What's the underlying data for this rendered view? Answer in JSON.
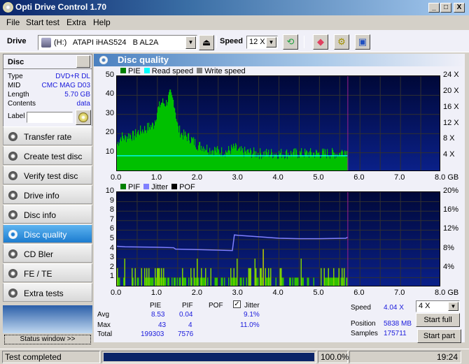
{
  "window": {
    "title": "Opti Drive Control 1.70",
    "minimize": "_",
    "maximize": "□",
    "close": "X"
  },
  "menu": [
    "File",
    "Start test",
    "Extra",
    "Help"
  ],
  "toolbar": {
    "drive_label": "Drive",
    "drive_value": "(H:)   ATAPI iHAS524   B AL2A",
    "speed_label": "Speed",
    "speed_value": "12 X"
  },
  "disc": {
    "header": "Disc",
    "rows": [
      {
        "key": "Type",
        "value": "DVD+R DL"
      },
      {
        "key": "MID",
        "value": "CMC MAG D03"
      },
      {
        "key": "Length",
        "value": "5.70 GB"
      },
      {
        "key": "Contents",
        "value": "data"
      }
    ],
    "label_key": "Label",
    "label_value": ""
  },
  "nav": [
    {
      "label": "Transfer rate",
      "active": false
    },
    {
      "label": "Create test disc",
      "active": false
    },
    {
      "label": "Verify test disc",
      "active": false
    },
    {
      "label": "Drive info",
      "active": false
    },
    {
      "label": "Disc info",
      "active": false
    },
    {
      "label": "Disc quality",
      "active": true
    },
    {
      "label": "CD Bler",
      "active": false
    },
    {
      "label": "FE / TE",
      "active": false
    },
    {
      "label": "Extra tests",
      "active": false
    }
  ],
  "status_window_button": "Status window >>",
  "panel_title": "Disc quality",
  "chart_data": [
    {
      "type": "bar",
      "title": "PIE / Read speed",
      "legend": [
        "PIE",
        "Read speed",
        "Write speed"
      ],
      "legend_colors": [
        "#008000",
        "#00ffff",
        "#808080"
      ],
      "xlabel": "GB",
      "x_ticks": [
        "0.0",
        "1.0",
        "2.0",
        "3.0",
        "4.0",
        "5.0",
        "6.0",
        "7.0",
        "8.0 GB"
      ],
      "xlim": [
        0,
        8
      ],
      "y_ticks": [
        "10",
        "20",
        "30",
        "40",
        "50"
      ],
      "ylim": [
        0,
        50
      ],
      "y2_ticks": [
        "4 X",
        "8 X",
        "12 X",
        "16 X",
        "20 X",
        "24 X"
      ],
      "y2lim": [
        0,
        24
      ],
      "data_end_gb": 5.7,
      "pie_profile": [
        [
          0.0,
          14
        ],
        [
          0.1,
          18
        ],
        [
          0.2,
          17
        ],
        [
          0.3,
          19
        ],
        [
          0.4,
          18
        ],
        [
          0.5,
          20
        ],
        [
          0.6,
          21
        ],
        [
          0.7,
          22
        ],
        [
          0.8,
          23
        ],
        [
          0.9,
          24
        ],
        [
          1.0,
          32
        ],
        [
          1.1,
          36
        ],
        [
          1.2,
          35
        ],
        [
          1.3,
          40
        ],
        [
          1.4,
          36
        ],
        [
          1.5,
          22
        ],
        [
          1.6,
          19
        ],
        [
          1.7,
          18
        ],
        [
          1.8,
          17
        ],
        [
          1.9,
          15
        ],
        [
          2.0,
          13
        ],
        [
          2.1,
          13
        ],
        [
          2.2,
          12
        ],
        [
          2.3,
          11
        ],
        [
          2.4,
          11
        ],
        [
          2.5,
          10
        ],
        [
          2.6,
          10
        ],
        [
          2.7,
          10
        ],
        [
          2.8,
          11
        ],
        [
          2.9,
          12
        ],
        [
          3.0,
          10
        ],
        [
          3.5,
          9
        ],
        [
          4.0,
          9
        ],
        [
          4.5,
          9
        ],
        [
          5.0,
          9
        ],
        [
          5.5,
          9
        ],
        [
          5.6,
          11
        ],
        [
          5.7,
          9
        ]
      ],
      "pie_max": 43,
      "read_speed_x": 4.04
    },
    {
      "type": "bar",
      "title": "PIF / Jitter",
      "legend": [
        "PIF",
        "Jitter",
        "POF"
      ],
      "legend_colors": [
        "#008000",
        "#8080ff",
        "#000000"
      ],
      "xlabel": "GB",
      "x_ticks": [
        "0.0",
        "1.0",
        "2.0",
        "3.0",
        "4.0",
        "5.0",
        "6.0",
        "7.0",
        "8.0 GB"
      ],
      "xlim": [
        0,
        8
      ],
      "y_ticks": [
        "1",
        "2",
        "3",
        "4",
        "5",
        "6",
        "7",
        "8",
        "9",
        "10"
      ],
      "ylim": [
        0,
        10
      ],
      "y2_ticks": [
        "4%",
        "8%",
        "12%",
        "16%",
        "20%"
      ],
      "y2lim": [
        0,
        20
      ],
      "data_end_gb": 5.7,
      "jitter_profile": [
        [
          0.0,
          8.6
        ],
        [
          0.2,
          8.5
        ],
        [
          1.0,
          8.4
        ],
        [
          1.4,
          8.3
        ],
        [
          1.45,
          8.0
        ],
        [
          2.0,
          7.9
        ],
        [
          2.5,
          7.8
        ],
        [
          2.85,
          7.7
        ],
        [
          2.9,
          11.0
        ],
        [
          3.0,
          10.9
        ],
        [
          3.5,
          10.6
        ],
        [
          4.0,
          10.3
        ],
        [
          4.5,
          10.2
        ],
        [
          5.0,
          10.2
        ],
        [
          5.65,
          10.3
        ],
        [
          5.7,
          10.5
        ]
      ],
      "pif_max": 4
    }
  ],
  "stats": {
    "headers": [
      "PIE",
      "PIF",
      "POF"
    ],
    "jitter_label": "Jitter",
    "jitter_checked": true,
    "rows": [
      {
        "label": "Avg",
        "pie": "8.53",
        "pif": "0.04",
        "pof": "",
        "jitter": "9.1%"
      },
      {
        "label": "Max",
        "pie": "43",
        "pif": "4",
        "pof": "",
        "jitter": "11.0%"
      },
      {
        "label": "Total",
        "pie": "199303",
        "pif": "7576",
        "pof": "",
        "jitter": ""
      }
    ]
  },
  "info": {
    "speed_label": "Speed",
    "speed_value": "4.04 X",
    "position_label": "Position",
    "position_value": "5838 MB",
    "samples_label": "Samples",
    "samples_value": "175711"
  },
  "controls": {
    "speed_select": "4 X",
    "start_full": "Start full",
    "start_part": "Start part"
  },
  "statusbar": {
    "message": "Test completed",
    "progress": 100.0,
    "progress_text": "100.0%",
    "time": "19:24"
  }
}
